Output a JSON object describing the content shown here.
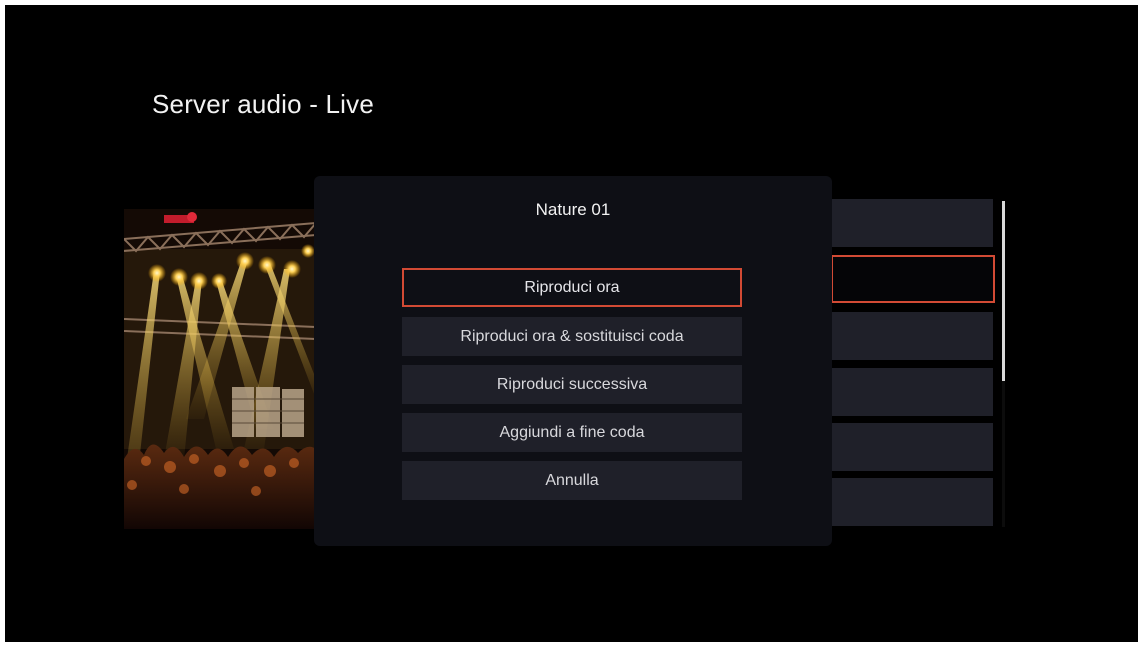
{
  "page": {
    "title": "Server audio - Live"
  },
  "album_art": {
    "icon": "concert-stage-image"
  },
  "dialog": {
    "title": "Nature 01",
    "menu": [
      {
        "label": "Riproduci ora",
        "focused": true
      },
      {
        "label": "Riproduci ora & sostituisci coda",
        "focused": false
      },
      {
        "label": "Riproduci successiva",
        "focused": false
      },
      {
        "label": "Aggiundi a fine coda",
        "focused": false
      },
      {
        "label": "Annulla",
        "focused": false
      }
    ]
  },
  "track_list": {
    "focused_index": 1,
    "row_count": 6
  },
  "colors": {
    "background": "#000000",
    "dialog_background": "#0e0f15",
    "row_background": "#1f2029",
    "focus_accent": "#d24a34",
    "text": "#f2f2f2"
  }
}
